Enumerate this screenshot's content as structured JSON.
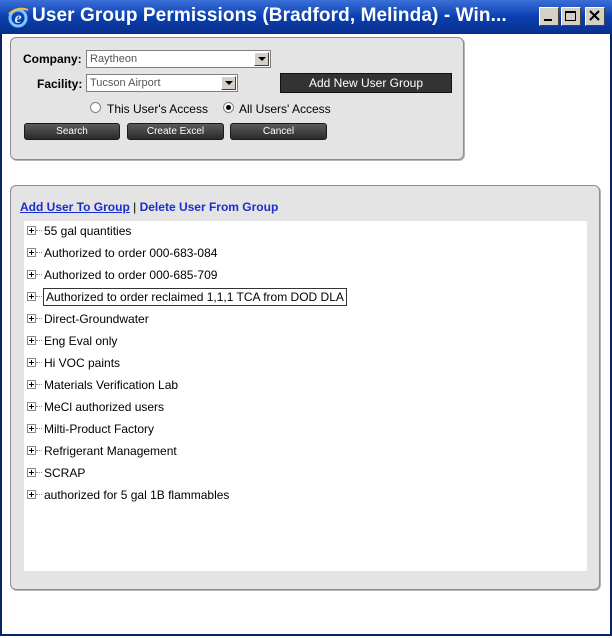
{
  "window": {
    "title": "User Group Permissions (Bradford, Melinda) - Win..."
  },
  "form": {
    "company_label": "Company:",
    "company_value": "Raytheon",
    "facility_label": "Facility:",
    "facility_value": "Tucson Airport",
    "add_group_label": "Add New User Group",
    "radio_this_label": "This User's Access",
    "radio_all_label": "All Users' Access",
    "radio_selected": "all",
    "search_label": "Search",
    "excel_label": "Create Excel",
    "cancel_label": "Cancel"
  },
  "actions": {
    "add_user_label": "Add User To Group",
    "separator": "|",
    "delete_user_label": "Delete User From Group"
  },
  "groups": [
    "55 gal quantities",
    "Authorized to order 000-683-084",
    "Authorized to order 000-685-709",
    "Authorized to order reclaimed 1,1,1 TCA from DOD DLA",
    "Direct-Groundwater",
    "Eng Eval only",
    "Hi VOC paints",
    "Materials Verification Lab",
    "MeCl authorized users",
    "Milti-Product Factory",
    "Refrigerant Management",
    "SCRAP",
    "authorized for 5 gal 1B flammables"
  ],
  "selected_group_index": 3,
  "icons": {
    "title": "internet-explorer-icon",
    "expand": "plus-box-icon"
  },
  "colors": {
    "titlebar": "#0a3fb0",
    "link": "#1a2ecc",
    "button_dark": "#333333",
    "panel": "#e4e4e4"
  }
}
